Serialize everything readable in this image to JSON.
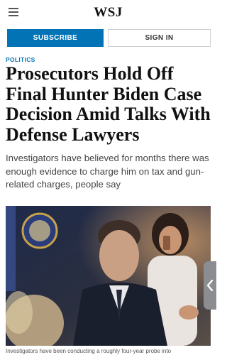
{
  "header": {
    "logo": "WSJ",
    "menu_icon": "hamburger-menu-icon"
  },
  "actions": {
    "subscribe_label": "SUBSCRIBE",
    "signin_label": "SIGN IN"
  },
  "article": {
    "section": "POLITICS",
    "headline": "Prosecutors Hold Off Final Hunter Biden Case Decision Amid Talks With Defense Lawyers",
    "dek": "Investigators have believed for months there was enough evidence to charge him on tax and gun-related charges, people say",
    "image_caption": "Investigators have been conducting a roughly four-year probe into"
  },
  "side_tab": {
    "icon": "chevron-left-icon"
  },
  "colors": {
    "accent": "#0274b6",
    "side_tab": "#8b8d90"
  }
}
